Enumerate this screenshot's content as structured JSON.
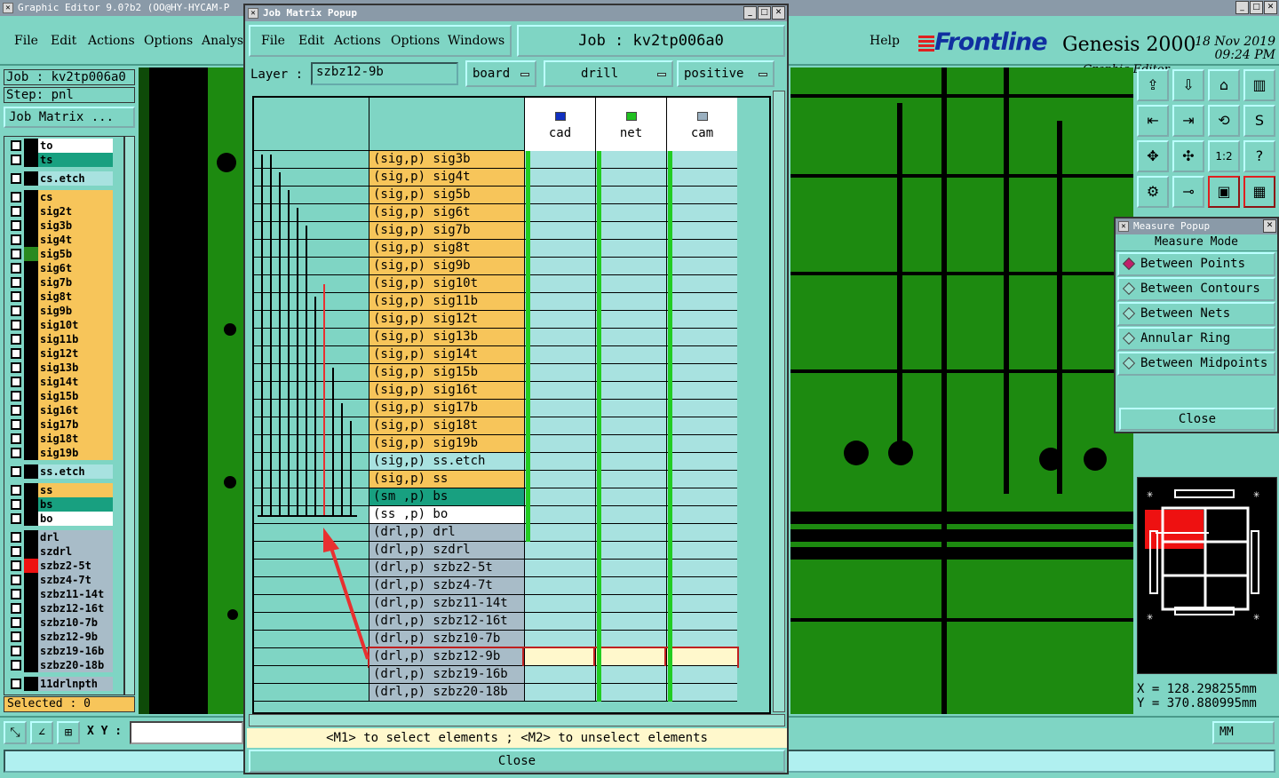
{
  "main": {
    "title": "Graphic Editor 9.0?b2  (OO@HY-HYCAM-P",
    "menu": [
      "File",
      "Edit",
      "Actions",
      "Options",
      "Analysi"
    ],
    "help": "Help",
    "logo": "Frontline",
    "product": "Genesis 2000",
    "subtitle": "Graphic Editor",
    "date": "18 Nov 2019",
    "time": "09:24 PM"
  },
  "left_panel": {
    "job": "Job : kv2tp006a0",
    "step": "Step: pnl",
    "job_matrix_btn": "Job Matrix ...",
    "selected": "Selected : 0",
    "layers": [
      {
        "name": "to",
        "bg": "#ffffff",
        "sw": "#000000"
      },
      {
        "name": "ts",
        "bg": "#18a080",
        "sw": "#000000"
      },
      {
        "name": "cs.etch",
        "bg": "#a8e2e0",
        "sw": "#000000",
        "gap": true
      },
      {
        "name": "cs",
        "bg": "#f7c55a",
        "sw": "#000000",
        "gap": true
      },
      {
        "name": "sig2t",
        "bg": "#f7c55a",
        "sw": "#000000"
      },
      {
        "name": "sig3b",
        "bg": "#f7c55a",
        "sw": "#000000"
      },
      {
        "name": "sig4t",
        "bg": "#f7c55a",
        "sw": "#000000"
      },
      {
        "name": "sig5b",
        "bg": "#f7c55a",
        "sw": "#2a8a20"
      },
      {
        "name": "sig6t",
        "bg": "#f7c55a",
        "sw": "#000000"
      },
      {
        "name": "sig7b",
        "bg": "#f7c55a",
        "sw": "#000000"
      },
      {
        "name": "sig8t",
        "bg": "#f7c55a",
        "sw": "#000000"
      },
      {
        "name": "sig9b",
        "bg": "#f7c55a",
        "sw": "#000000"
      },
      {
        "name": "sig10t",
        "bg": "#f7c55a",
        "sw": "#000000"
      },
      {
        "name": "sig11b",
        "bg": "#f7c55a",
        "sw": "#000000"
      },
      {
        "name": "sig12t",
        "bg": "#f7c55a",
        "sw": "#000000"
      },
      {
        "name": "sig13b",
        "bg": "#f7c55a",
        "sw": "#000000"
      },
      {
        "name": "sig14t",
        "bg": "#f7c55a",
        "sw": "#000000"
      },
      {
        "name": "sig15b",
        "bg": "#f7c55a",
        "sw": "#000000"
      },
      {
        "name": "sig16t",
        "bg": "#f7c55a",
        "sw": "#000000"
      },
      {
        "name": "sig17b",
        "bg": "#f7c55a",
        "sw": "#000000"
      },
      {
        "name": "sig18t",
        "bg": "#f7c55a",
        "sw": "#000000"
      },
      {
        "name": "sig19b",
        "bg": "#f7c55a",
        "sw": "#000000"
      },
      {
        "name": "ss.etch",
        "bg": "#a8e2e0",
        "sw": "#000000",
        "gap": true
      },
      {
        "name": "ss",
        "bg": "#f7c55a",
        "sw": "#000000",
        "gap": true
      },
      {
        "name": "bs",
        "bg": "#18a080",
        "sw": "#000000"
      },
      {
        "name": "bo",
        "bg": "#ffffff",
        "sw": "#000000"
      },
      {
        "name": "drl",
        "bg": "#a8bcc8",
        "sw": "#000000",
        "gap": true
      },
      {
        "name": "szdrl",
        "bg": "#a8bcc8",
        "sw": "#000000"
      },
      {
        "name": "szbz2-5t",
        "bg": "#a8bcc8",
        "sw": "#ee1111"
      },
      {
        "name": "szbz4-7t",
        "bg": "#a8bcc8",
        "sw": "#000000"
      },
      {
        "name": "szbz11-14t",
        "bg": "#a8bcc8",
        "sw": "#000000"
      },
      {
        "name": "szbz12-16t",
        "bg": "#a8bcc8",
        "sw": "#000000"
      },
      {
        "name": "szbz10-7b",
        "bg": "#a8bcc8",
        "sw": "#000000"
      },
      {
        "name": "szbz12-9b",
        "bg": "#a8bcc8",
        "sw": "#000000"
      },
      {
        "name": "szbz19-16b",
        "bg": "#a8bcc8",
        "sw": "#000000"
      },
      {
        "name": "szbz20-18b",
        "bg": "#a8bcc8",
        "sw": "#000000"
      },
      {
        "name": "11drlnpth",
        "bg": "#a8bcc8",
        "sw": "#000000",
        "gap": true
      }
    ]
  },
  "bottom": {
    "xy_label": "X Y :",
    "units": "MM",
    "coord_x": "X  =  128.298255mm",
    "coord_y": "Y  =  370.880995mm"
  },
  "measure_popup": {
    "title": "Measure Popup",
    "mode_label": "Measure Mode",
    "options": [
      "Between Points",
      "Between Contours",
      "Between Nets",
      "Annular Ring",
      "Between Midpoints"
    ],
    "selected_index": 0,
    "close": "Close"
  },
  "job_matrix": {
    "title": "Job Matrix Popup",
    "menu": [
      "File",
      "Edit",
      "Actions",
      "Options",
      "Windows"
    ],
    "job": "Job  :  kv2tp006a0",
    "layer_label": "Layer  :",
    "layer_value": "szbz12-9b",
    "context": "board",
    "type": "drill",
    "polarity": "positive",
    "columns": [
      {
        "name": "cad",
        "color": "#1030c0"
      },
      {
        "name": "net",
        "color": "#20c020"
      },
      {
        "name": "cam",
        "color": "#9ab0c0"
      }
    ],
    "rows": [
      {
        "label": "(sig,p) sig3b",
        "bg": "#f7c55a"
      },
      {
        "label": "(sig,p) sig4t",
        "bg": "#f7c55a"
      },
      {
        "label": "(sig,p) sig5b",
        "bg": "#f7c55a"
      },
      {
        "label": "(sig,p) sig6t",
        "bg": "#f7c55a"
      },
      {
        "label": "(sig,p) sig7b",
        "bg": "#f7c55a"
      },
      {
        "label": "(sig,p) sig8t",
        "bg": "#f7c55a"
      },
      {
        "label": "(sig,p) sig9b",
        "bg": "#f7c55a"
      },
      {
        "label": "(sig,p) sig10t",
        "bg": "#f7c55a"
      },
      {
        "label": "(sig,p) sig11b",
        "bg": "#f7c55a"
      },
      {
        "label": "(sig,p) sig12t",
        "bg": "#f7c55a"
      },
      {
        "label": "(sig,p) sig13b",
        "bg": "#f7c55a"
      },
      {
        "label": "(sig,p) sig14t",
        "bg": "#f7c55a"
      },
      {
        "label": "(sig,p) sig15b",
        "bg": "#f7c55a"
      },
      {
        "label": "(sig,p) sig16t",
        "bg": "#f7c55a"
      },
      {
        "label": "(sig,p) sig17b",
        "bg": "#f7c55a"
      },
      {
        "label": "(sig,p) sig18t",
        "bg": "#f7c55a"
      },
      {
        "label": "(sig,p) sig19b",
        "bg": "#f7c55a"
      },
      {
        "label": "(sig,p) ss.etch",
        "bg": "#a8e2e0"
      },
      {
        "label": "(sig,p) ss",
        "bg": "#f7c55a"
      },
      {
        "label": "(sm ,p) bs",
        "bg": "#18a080"
      },
      {
        "label": "(ss ,p) bo",
        "bg": "#ffffff"
      },
      {
        "label": "(drl,p) drl",
        "bg": "#a8bcc8"
      },
      {
        "label": "(drl,p) szdrl",
        "bg": "#a8bcc8"
      },
      {
        "label": "(drl,p) szbz2-5t",
        "bg": "#a8bcc8"
      },
      {
        "label": "(drl,p) szbz4-7t",
        "bg": "#a8bcc8"
      },
      {
        "label": "(drl,p) szbz11-14t",
        "bg": "#a8bcc8"
      },
      {
        "label": "(drl,p) szbz12-16t",
        "bg": "#a8bcc8"
      },
      {
        "label": "(drl,p) szbz10-7b",
        "bg": "#a8bcc8"
      },
      {
        "label": "(drl,p) szbz12-9b",
        "bg": "#a8bcc8",
        "selected": true
      },
      {
        "label": "(drl,p) szbz19-16b",
        "bg": "#a8bcc8"
      },
      {
        "label": "(drl,p) szbz20-18b",
        "bg": "#a8bcc8"
      }
    ],
    "hint": "<M1> to select elements ; <M2> to unselect elements",
    "close": "Close"
  },
  "colors": {
    "panel": "#7fd5c4",
    "signal": "#f7c55a",
    "drill": "#a8bcc8",
    "trace": "#1d8a10",
    "selected_span": "#e83030"
  }
}
